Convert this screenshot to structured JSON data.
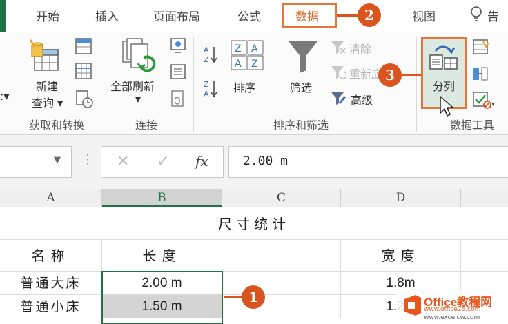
{
  "ribbon_tabs": {
    "home": "开始",
    "insert": "插入",
    "page_layout": "页面布局",
    "formulas": "公式",
    "data": "数据",
    "view": "视图",
    "tell_me": "告"
  },
  "groups": {
    "get_transform": {
      "label": "获取和转换",
      "new_query": "新建",
      "query": "查询 ▾"
    },
    "connections": {
      "label": "连接",
      "refresh_all": "全部刷新"
    },
    "sort_filter": {
      "label": "排序和筛选",
      "sort": "排序",
      "filter": "筛选",
      "clear": "清除",
      "reapply": "重新应用",
      "advanced": "高级"
    },
    "data_tools": {
      "label": "数据工具",
      "text_to_columns": "分列"
    }
  },
  "formula_bar": {
    "fx": "fx",
    "value": "2.00 m"
  },
  "grid": {
    "columns": [
      "A",
      "B",
      "C",
      "D"
    ],
    "title": "尺寸统计",
    "headers": {
      "name": "名称",
      "length": "长度",
      "width": "宽度"
    },
    "rows": [
      {
        "name": "普通大床",
        "length": "2.00 m",
        "width": "1.8m"
      },
      {
        "name": "普通小床",
        "length": "1.50 m",
        "width": "1.2m"
      }
    ]
  },
  "markers": [
    "1",
    "2",
    "3"
  ],
  "watermark": {
    "brand": "Office教程网",
    "url": "www.office26.com",
    "url2": "www.excelcw.com"
  },
  "colors": {
    "accent_orange": "#d9541e",
    "excel_green": "#217346",
    "selection_fill": "#dce9e1"
  }
}
